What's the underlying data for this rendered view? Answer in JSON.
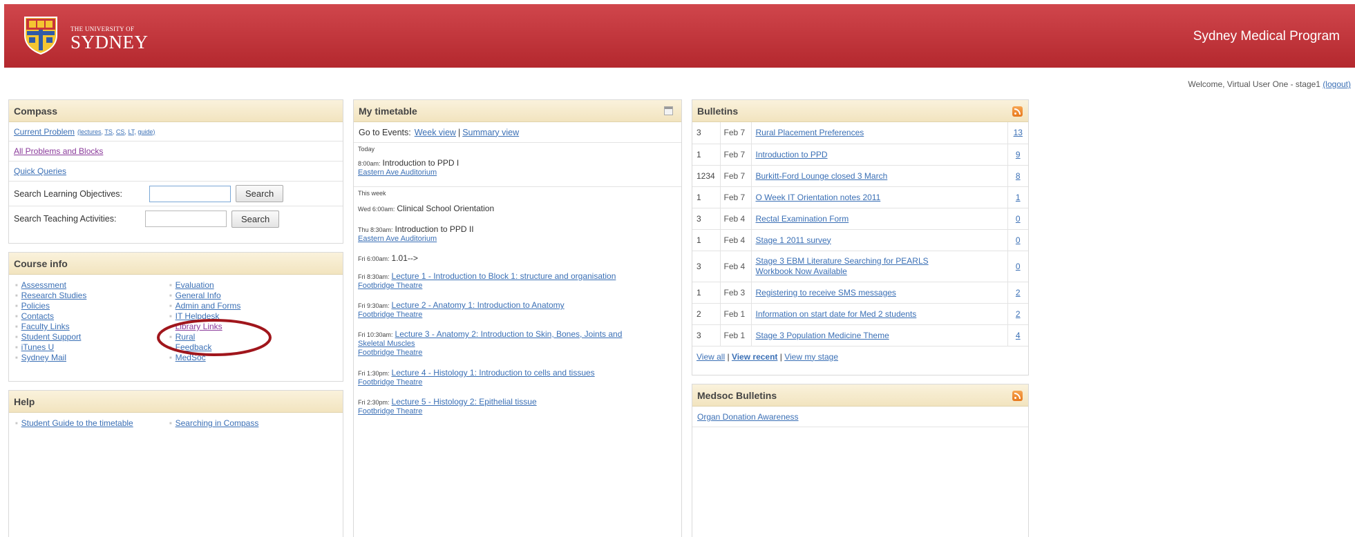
{
  "header": {
    "logo_small": "THE UNIVERSITY OF",
    "logo_big": "SYDNEY",
    "program": "Sydney Medical Program",
    "colors": {
      "bar": "#c0363c",
      "panel_head": "#f5e9c8",
      "link": "#3a6fb5",
      "visited": "#8a3a9a",
      "annotation": "#a0161c"
    }
  },
  "welcome": {
    "text": "Welcome, Virtual User One - stage1",
    "logout": "(logout)"
  },
  "compass": {
    "title": "Compass",
    "current_problem": "Current Problem",
    "current_problem_sub": [
      "(lectures,",
      "TS,",
      "CS,",
      "LT,",
      "guide)"
    ],
    "all_problems": "All Problems and Blocks",
    "quick_queries": "Quick Queries",
    "search_lo_label": "Search Learning Objectives:",
    "search_ta_label": "Search Teaching Activities:",
    "search_button": "Search"
  },
  "course_info": {
    "title": "Course info",
    "left": [
      "Assessment",
      "Research Studies",
      "Policies",
      "Contacts",
      "Faculty Links",
      "Student Support",
      "iTunes U",
      "Sydney Mail"
    ],
    "right": [
      "Evaluation",
      "General Info",
      "Admin and Forms",
      "IT Helpdesk",
      "Library Links",
      "Rural",
      "Feedback",
      "MedSoc"
    ]
  },
  "help": {
    "title": "Help",
    "items": [
      "Student Guide to the timetable",
      "Searching in Compass"
    ]
  },
  "timetable": {
    "title": "My timetable",
    "goto_label": "Go to Events:",
    "week_view": "Week view",
    "summary_view": "Summary view",
    "today_label": "Today",
    "this_week_label": "This week",
    "events": [
      {
        "time": "8:00am:",
        "title": "Introduction to PPD I",
        "loc": "Eastern Ave Auditorium",
        "link": false
      },
      {
        "time": "Wed 6:00am:",
        "title": "Clinical School Orientation",
        "loc": "",
        "link": false
      },
      {
        "time": "Thu 8:30am:",
        "title": "Introduction to PPD II",
        "loc": "Eastern Ave Auditorium",
        "link": false
      },
      {
        "time": "Fri 6:00am:",
        "title": "1.01-->",
        "loc": "",
        "link": false
      },
      {
        "time": "Fri 8:30am:",
        "title": "Lecture 1 - Introduction to Block 1: structure and organisation",
        "loc": "Footbridge Theatre",
        "link": true
      },
      {
        "time": "Fri 9:30am:",
        "title": "Lecture 2 - Anatomy 1: Introduction to Anatomy",
        "loc": "Footbridge Theatre",
        "link": true
      },
      {
        "time": "Fri 10:30am:",
        "title": "Lecture 3 - Anatomy 2: Introduction to Skin, Bones, Joints and",
        "title2": "Skeletal Muscles",
        "loc": "Footbridge Theatre",
        "link": true
      },
      {
        "time": "Fri 1:30pm:",
        "title": "Lecture 4 - Histology 1: Introduction to cells and tissues",
        "loc": "Footbridge Theatre",
        "link": true
      },
      {
        "time": "Fri 2:30pm:",
        "title": "Lecture 5 - Histology 2: Epithelial tissue",
        "loc": "Footbridge Theatre",
        "link": true
      }
    ]
  },
  "bulletins": {
    "title": "Bulletins",
    "rows": [
      {
        "id": "3",
        "date": "Feb 7",
        "title": "Rural Placement Preferences",
        "count": "13"
      },
      {
        "id": "1",
        "date": "Feb 7",
        "title": "Introduction to PPD",
        "count": "9"
      },
      {
        "id": "1234",
        "date": "Feb 7",
        "title": "Burkitt-Ford Lounge closed 3 March",
        "count": "8"
      },
      {
        "id": "1",
        "date": "Feb 7",
        "title": "O Week IT Orientation notes 2011",
        "count": "1"
      },
      {
        "id": "3",
        "date": "Feb 4",
        "title": "Rectal Examination Form",
        "count": "0"
      },
      {
        "id": "1",
        "date": "Feb 4",
        "title": "Stage 1 2011 survey",
        "count": "0"
      },
      {
        "id": "3",
        "date": "Feb 4",
        "title": "Stage 3 EBM Literature Searching for PEARLS",
        "title2": "Workbook Now Available",
        "count": "0"
      },
      {
        "id": "1",
        "date": "Feb 3",
        "title": "Registering to receive SMS messages",
        "count": "2"
      },
      {
        "id": "2",
        "date": "Feb 1",
        "title": "Information on start date for Med 2 students",
        "count": "2"
      },
      {
        "id": "3",
        "date": "Feb 1",
        "title": "Stage 3 Population Medicine Theme",
        "count": "4"
      }
    ],
    "view_all": "View all",
    "view_recent": "View recent",
    "view_stage": "View my stage"
  },
  "medsoc": {
    "title": "Medsoc Bulletins",
    "items": [
      "Organ Donation Awareness"
    ]
  }
}
